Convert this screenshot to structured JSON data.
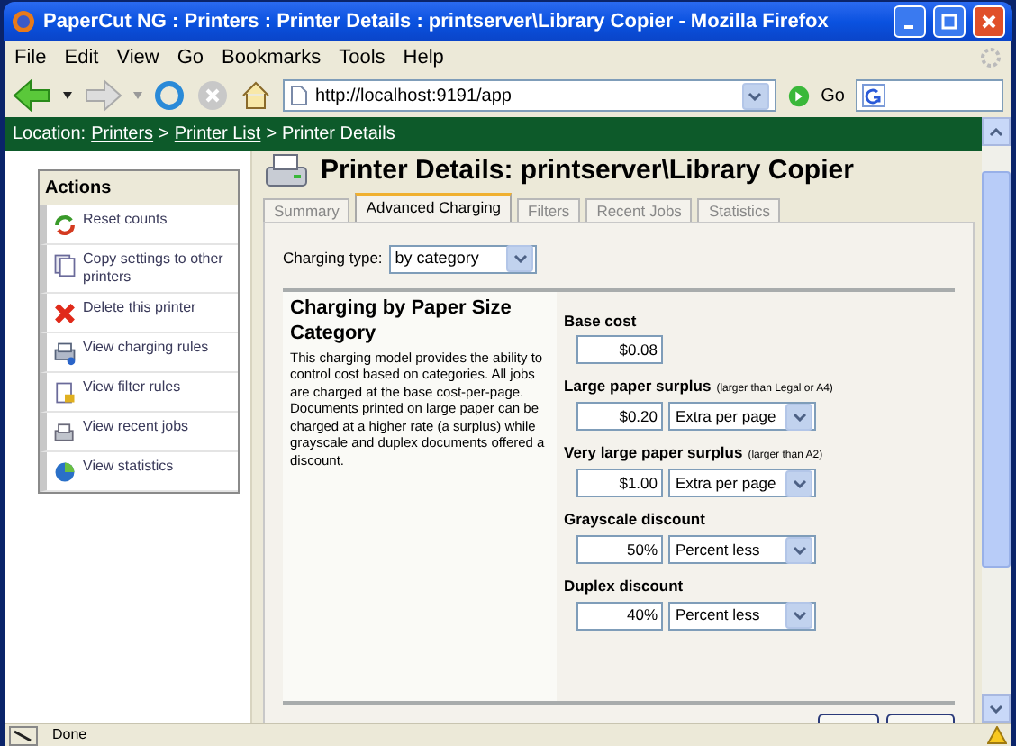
{
  "window": {
    "title": "PaperCut NG : Printers : Printer Details : printserver\\Library Copier - Mozilla Firefox"
  },
  "menu": [
    "File",
    "Edit",
    "View",
    "Go",
    "Bookmarks",
    "Tools",
    "Help"
  ],
  "toolbar": {
    "url": "http://localhost:9191/app",
    "go": "Go"
  },
  "location": {
    "label": "Location:",
    "crumbs": [
      {
        "text": "Printers",
        "link": true
      },
      {
        "text": "Printer List",
        "link": true
      },
      {
        "text": "Printer Details",
        "link": false
      }
    ],
    "separator": ">"
  },
  "actions": {
    "title": "Actions",
    "items": [
      {
        "label": "Reset counts",
        "kind": "reset"
      },
      {
        "label": "Copy settings to other printers",
        "kind": "copy"
      },
      {
        "label": "Delete this printer",
        "kind": "delete"
      },
      {
        "label": "View charging rules",
        "kind": "rules"
      },
      {
        "label": "View filter rules",
        "kind": "filter"
      },
      {
        "label": "View recent jobs",
        "kind": "jobs"
      },
      {
        "label": "View statistics",
        "kind": "stats"
      }
    ]
  },
  "page_title": "Printer Details: printserver\\Library Copier",
  "tabs": [
    {
      "label": "Summary",
      "selected": false
    },
    {
      "label": "Advanced Charging",
      "selected": true
    },
    {
      "label": "Filters",
      "selected": false
    },
    {
      "label": "Recent Jobs",
      "selected": false
    },
    {
      "label": "Statistics",
      "selected": false
    }
  ],
  "charging_type": {
    "label": "Charging type:",
    "value": "by category"
  },
  "description": {
    "title": "Charging by Paper Size Category",
    "body": "This charging model provides the ability to control cost based on categories. All jobs are charged at the base cost-per-page. Documents printed on large paper can be charged at a higher rate (a surplus) while grayscale and duplex documents offered a discount."
  },
  "fields": [
    {
      "label": "Base cost",
      "value": "$0.08"
    },
    {
      "label": "Large paper surplus",
      "note": "(larger than Legal or A4)",
      "value": "$0.20",
      "mode": "Extra per page"
    },
    {
      "label": "Very large paper surplus",
      "note": "(larger than A2)",
      "value": "$1.00",
      "mode": "Extra per page"
    },
    {
      "label": "Grayscale discount",
      "value": "50%",
      "mode": "Percent less"
    },
    {
      "label": "Duplex discount",
      "value": "40%",
      "mode": "Percent less"
    }
  ],
  "status_bar": {
    "text": "Done"
  }
}
